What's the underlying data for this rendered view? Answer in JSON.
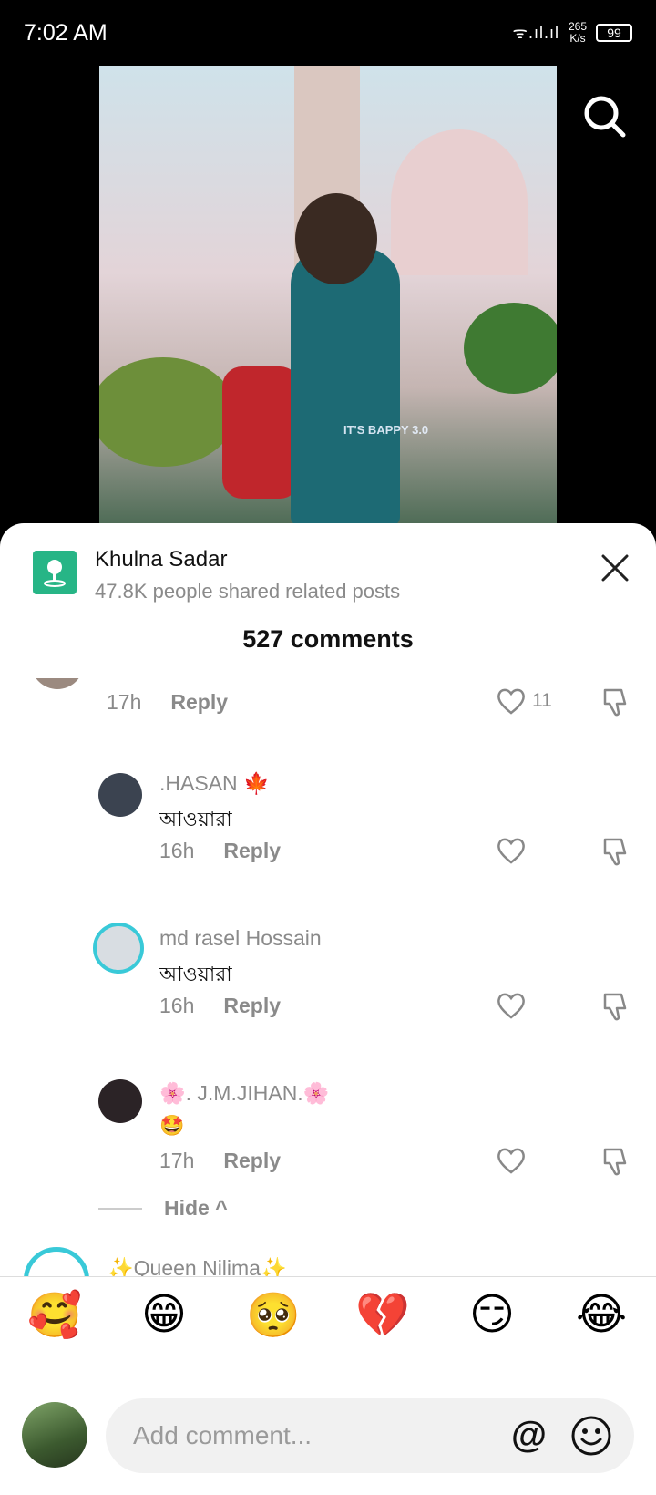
{
  "status_bar": {
    "time": "7:02 AM",
    "signal": "ᯤ.ıl.ıl",
    "speed_value": "265",
    "speed_unit": "K/s",
    "battery": "99"
  },
  "video": {
    "watermark": "IT'S BAPPY 3.0"
  },
  "location": {
    "name": "Khulna Sadar",
    "subtitle": "47.8K people shared related posts"
  },
  "comments_header": "527 comments",
  "comments": [
    {
      "author": "",
      "text": "",
      "time": "17h",
      "reply": "Reply",
      "likes": "11"
    },
    {
      "author": ".HASAN 🍁",
      "text": "আওয়ারা",
      "time": "16h",
      "reply": "Reply",
      "likes": ""
    },
    {
      "author": "md rasel Hossain",
      "text": "আওয়ারা",
      "time": "16h",
      "reply": "Reply",
      "likes": ""
    },
    {
      "author": "🌸. J.M.JIHAN.🌸",
      "text": "🤩",
      "time": "17h",
      "reply": "Reply",
      "likes": ""
    }
  ],
  "hide_label": "Hide ^",
  "next_comment_author": "✨Queen Nilima✨",
  "quick_emojis": [
    "🥰",
    "😁",
    "🥺",
    "💔",
    "😏",
    "😂"
  ],
  "input": {
    "placeholder": "Add comment...",
    "mention": "@"
  }
}
